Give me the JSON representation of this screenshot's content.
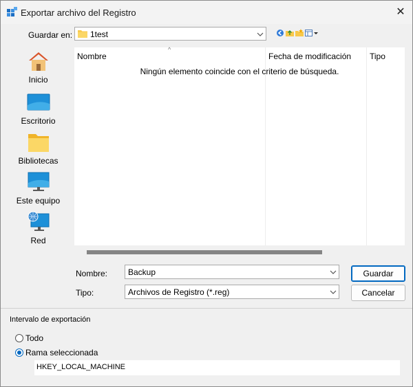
{
  "window": {
    "title": "Exportar archivo del Registro",
    "close_glyph": "✕",
    "icon": "registry-icon"
  },
  "save_in": {
    "label": "Guardar en:",
    "value": "1test",
    "icon": "folder-icon"
  },
  "toolbar": {
    "icons": [
      "back-icon",
      "up-folder-icon",
      "new-folder-icon",
      "view-menu-icon"
    ]
  },
  "places": [
    {
      "label": "Inicio",
      "icon": "home-icon"
    },
    {
      "label": "Escritorio",
      "icon": "desktop-icon"
    },
    {
      "label": "Bibliotecas",
      "icon": "libraries-icon"
    },
    {
      "label": "Este equipo",
      "icon": "this-pc-icon"
    },
    {
      "label": "Red",
      "icon": "network-icon"
    }
  ],
  "file_list": {
    "columns": [
      "Nombre",
      "Fecha de modificación",
      "Tipo"
    ],
    "empty_message": "Ningún elemento coincide con el criterio de búsqueda."
  },
  "filename": {
    "label": "Nombre:",
    "value": "Backup"
  },
  "filetype": {
    "label": "Tipo:",
    "value": "Archivos de Registro (*.reg)"
  },
  "buttons": {
    "save": "Guardar",
    "cancel": "Cancelar"
  },
  "export_range": {
    "title": "Intervalo de exportación",
    "all_label": "Todo",
    "branch_label": "Rama seleccionada",
    "selected": "branch",
    "branch_value": "HKEY_LOCAL_MACHINE"
  },
  "colors": {
    "accent": "#0067c0",
    "folder": "#f8c84a",
    "desktop": "#1e90d8"
  }
}
